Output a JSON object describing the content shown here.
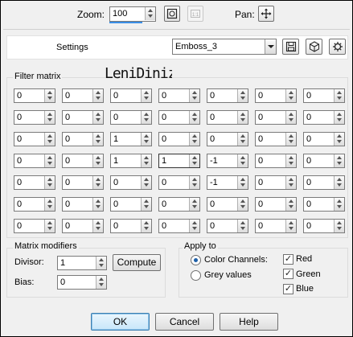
{
  "zoom": {
    "label": "Zoom:",
    "value": "100"
  },
  "pan": {
    "label": "Pan:"
  },
  "settings": {
    "label": "Settings",
    "preset": "Emboss_3"
  },
  "filter_matrix": {
    "title": "Filter matrix",
    "watermark": "LeniDiniz",
    "rows": [
      [
        "0",
        "0",
        "0",
        "0",
        "0",
        "0",
        "0"
      ],
      [
        "0",
        "0",
        "0",
        "0",
        "0",
        "0",
        "0"
      ],
      [
        "0",
        "0",
        "1",
        "0",
        "0",
        "0",
        "0"
      ],
      [
        "0",
        "0",
        "1",
        "1",
        "-1",
        "0",
        "0"
      ],
      [
        "0",
        "0",
        "0",
        "0",
        "-1",
        "0",
        "0"
      ],
      [
        "0",
        "0",
        "0",
        "0",
        "0",
        "0",
        "0"
      ],
      [
        "0",
        "0",
        "0",
        "0",
        "0",
        "0",
        "0"
      ]
    ]
  },
  "modifiers": {
    "title": "Matrix modifiers",
    "divisor_label": "Divisor:",
    "divisor": "1",
    "bias_label": "Bias:",
    "bias": "0",
    "compute_label": "Compute"
  },
  "apply_to": {
    "title": "Apply to",
    "color_channels": "Color Channels:",
    "grey_values": "Grey values",
    "red": "Red",
    "green": "Green",
    "blue": "Blue"
  },
  "buttons": {
    "ok": "OK",
    "cancel": "Cancel",
    "help": "Help"
  }
}
